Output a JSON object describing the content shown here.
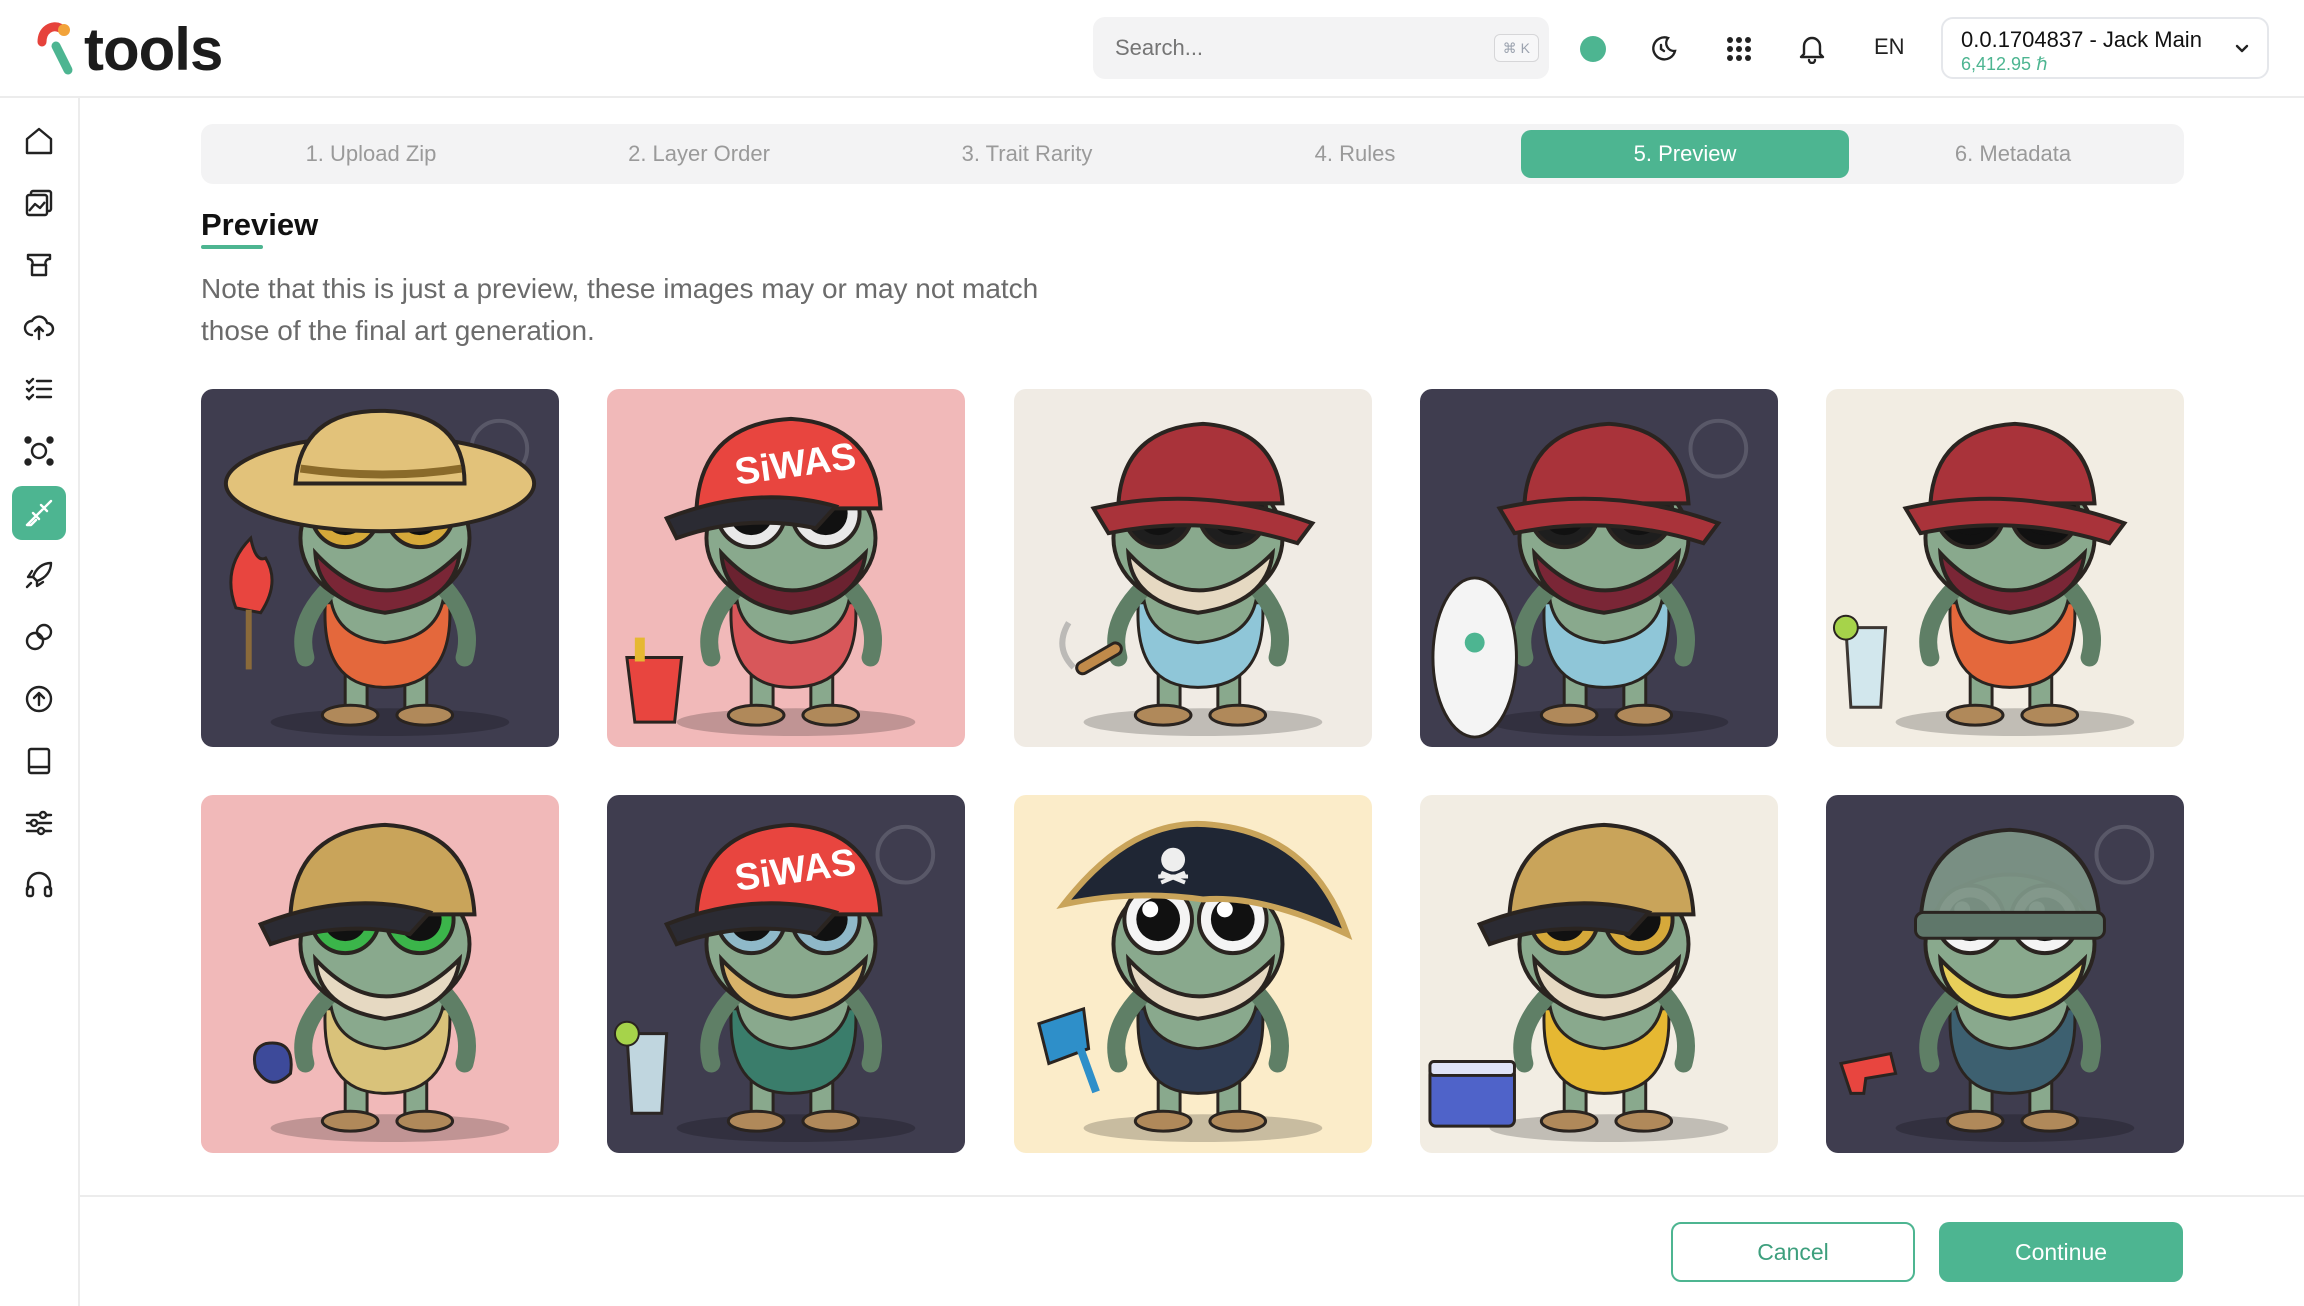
{
  "app": {
    "name": "tools"
  },
  "colors": {
    "accent": "#4db591",
    "status": "#4db591"
  },
  "header": {
    "search_placeholder": "Search...",
    "search_shortcut": "⌘ K",
    "language": "EN",
    "account": {
      "name": "0.0.1704837 - Jack Main",
      "balance": "6,412.95 ℏ"
    },
    "icons": [
      "theme-toggle-icon",
      "apps-grid-icon",
      "bell-icon",
      "chevron-down-icon"
    ]
  },
  "sidebar": {
    "items": [
      {
        "icon": "home-icon"
      },
      {
        "icon": "gallery-icon"
      },
      {
        "icon": "ticket-icon"
      },
      {
        "icon": "cloud-upload-icon"
      },
      {
        "icon": "checklist-icon"
      },
      {
        "icon": "network-icon"
      },
      {
        "icon": "paintbrush-icon",
        "active": true
      },
      {
        "icon": "rocket-icon"
      },
      {
        "icon": "link-icon"
      },
      {
        "icon": "upload-circle-icon"
      },
      {
        "icon": "book-icon"
      },
      {
        "icon": "sliders-icon"
      },
      {
        "icon": "headset-icon"
      }
    ]
  },
  "steps": [
    {
      "label": "1. Upload Zip"
    },
    {
      "label": "2. Layer Order"
    },
    {
      "label": "3. Trait Rarity"
    },
    {
      "label": "4. Rules"
    },
    {
      "label": "5. Preview",
      "active": true
    },
    {
      "label": "6. Metadata"
    }
  ],
  "page": {
    "title": "Preview",
    "note": "Note that this is just a preview, these images may or may not match those of the final art generation."
  },
  "previews": [
    {
      "bg": "#3f3d4f",
      "hat": "straw-hat",
      "hat_color": "#e2c27a",
      "mask": "#7a2636",
      "glasses": "#d6a93a",
      "shorts": "#e4683c",
      "item": "flame"
    },
    {
      "bg": "#f1b9b9",
      "hat": "cap",
      "hat_color": "#e8453f",
      "hat_text": "SiWAS",
      "mask": "#6b2230",
      "glasses": "#e9e9e9",
      "shorts": "#d8575a",
      "item": "bucket"
    },
    {
      "bg": "#f0ebe4",
      "hat": "bucket-hat",
      "hat_color": "#a9333a",
      "mask": "#e6d9c2",
      "glasses": "#1e1e1e",
      "shorts": "#8fc6d8",
      "item": "cigar"
    },
    {
      "bg": "#3f3d4f",
      "hat": "bucket-hat",
      "hat_color": "#a9333a",
      "mask": "#7a2636",
      "glasses": "#1e1e1e",
      "shorts": "#8fc6d8",
      "item": "surfboard"
    },
    {
      "bg": "#f2ede3",
      "hat": "bucket-hat",
      "hat_color": "#a9333a",
      "mask": "#7a2636",
      "glasses": "#111111",
      "shorts": "#e4683c",
      "item": "drink"
    },
    {
      "bg": "#f1b9b9",
      "hat": "cap",
      "hat_color": "#c9a45a",
      "mask": "#e6d9c2",
      "glasses": "#3bb54a",
      "shorts": "#d9c27a",
      "item": "potion"
    },
    {
      "bg": "#3f3d4f",
      "hat": "cap",
      "hat_color": "#e8453f",
      "hat_text": "SiWAS",
      "mask": "#d9b36a",
      "glasses": "#8fb9c9",
      "shorts": "#3a7d6b",
      "item": "drink"
    },
    {
      "bg": "#fbecc9",
      "hat": "pirate-hat",
      "hat_color": "#1f2634",
      "mask": "#e6d9c2",
      "glasses": "#f4f4f4",
      "shorts": "#2f3b52",
      "item": "shovel"
    },
    {
      "bg": "#f2ede3",
      "hat": "cap",
      "hat_color": "#c9a45a",
      "mask": "#e6d9c2",
      "glasses": "#d6a93a",
      "shorts": "#e6b832",
      "item": "cooler"
    },
    {
      "bg": "#3f3d4f",
      "hat": "beanie",
      "hat_color": "#7d9486",
      "mask": "#e8cf5a",
      "glasses": "#f4f4f4",
      "shorts": "#3d6070",
      "item": "water-gun"
    }
  ],
  "footer": {
    "cancel_label": "Cancel",
    "continue_label": "Continue"
  }
}
